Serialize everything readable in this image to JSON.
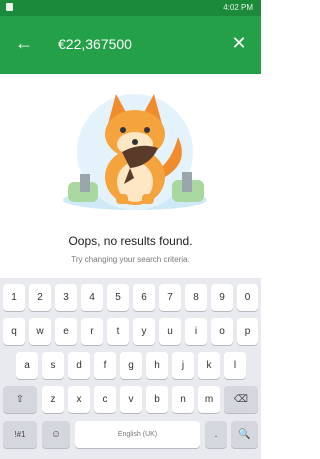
{
  "status_bar": {
    "time": "4:02 PM"
  },
  "app_bar": {
    "back_icon": "arrow-back-icon",
    "search_value": "€22,367500",
    "close_icon": "close-icon",
    "colors": {
      "app_bar": "#24a148",
      "status_bar": "#1b8a3a"
    }
  },
  "empty_state": {
    "title": "Oops, no results found.",
    "hint": "Try changing your search criteria."
  },
  "keyboard": {
    "number_row": [
      "1",
      "2",
      "3",
      "4",
      "5",
      "6",
      "7",
      "8",
      "9",
      "0"
    ],
    "row1": [
      "q",
      "w",
      "e",
      "r",
      "t",
      "y",
      "u",
      "i",
      "o",
      "p"
    ],
    "row2": [
      "a",
      "s",
      "d",
      "f",
      "g",
      "h",
      "j",
      "k",
      "l"
    ],
    "row3": [
      "z",
      "x",
      "c",
      "v",
      "b",
      "n",
      "m"
    ],
    "shift_label": "⇧",
    "backspace_label": "⌫",
    "symbols_label": "!#1",
    "emoji_label": "☺",
    "space_label": "English (UK)",
    "period_label": ".",
    "search_label": "🔍"
  }
}
